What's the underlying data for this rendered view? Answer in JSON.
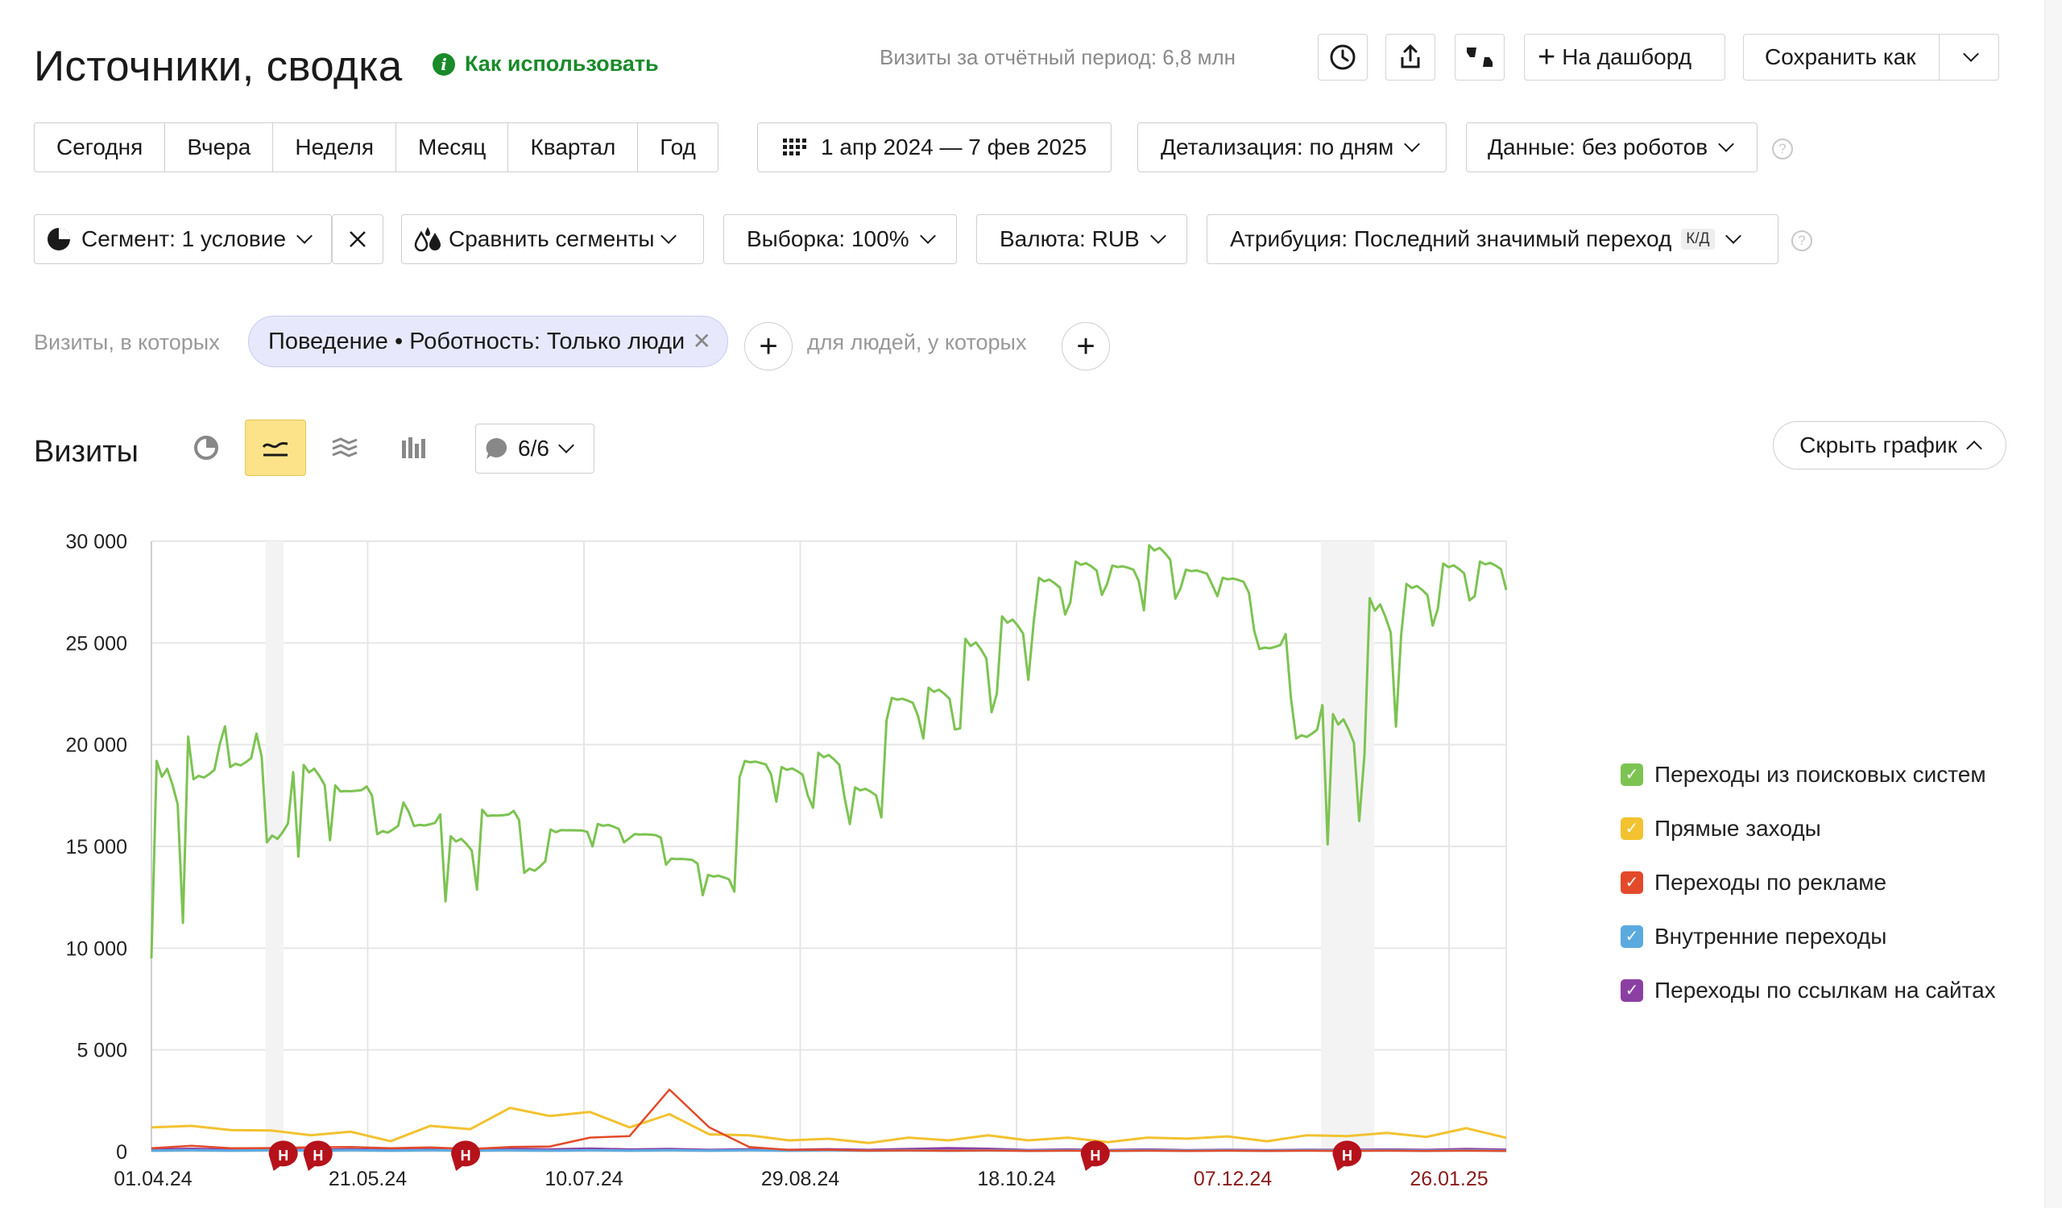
{
  "header": {
    "title": "Источники, сводка",
    "howto_label": "Как использовать",
    "visits_total": "Визиты за отчётный период: 6,8 млн",
    "dashboard_label": "На дашборд",
    "save_as_label": "Сохранить как"
  },
  "period": {
    "tabs": [
      "Сегодня",
      "Вчера",
      "Неделя",
      "Месяц",
      "Квартал",
      "Год"
    ],
    "date_range": "1 апр 2024 — 7 фев 2025",
    "detail": "Детализация: по дням",
    "data": "Данные: без роботов"
  },
  "controls": {
    "segment": "Сегмент: 1 условие",
    "compare": "Сравнить сегменты",
    "sample": "Выборка: 100%",
    "currency": "Валюта: RUB",
    "attribution": "Атрибуция: Последний значимый переход",
    "attribution_badge": "К/Д"
  },
  "filter": {
    "visits_where": "Визиты, в которых",
    "chip": "Поведение • Роботность: Только люди",
    "people_where": "для людей, у которых"
  },
  "chart_header": {
    "title": "Визиты",
    "series_count": "6/6",
    "hide_chart": "Скрыть график"
  },
  "colors": {
    "search": "#7dc352",
    "direct": "#f2c230",
    "ads": "#e24a2a",
    "internal": "#5aaae0",
    "links": "#8c3fa3",
    "accent_green": "#1a8a2a",
    "holiday_marker": "#b5121b"
  },
  "chart_data": {
    "type": "line",
    "x_ticks": [
      "01.04.24",
      "21.05.24",
      "10.07.24",
      "29.08.24",
      "18.10.24",
      "07.12.24",
      "26.01.25"
    ],
    "y_ticks": [
      "30 000",
      "25 000",
      "20 000",
      "15 000",
      "10 000",
      "5 000",
      "0"
    ],
    "ylim": [
      0,
      30000
    ],
    "x_range": [
      "2024-04-01",
      "2025-02-07"
    ],
    "grid": true,
    "legend_position": "right",
    "holiday_marker_label": "Н",
    "series": [
      {
        "name": "Переходы из поисковых систем",
        "color": "#7dc352",
        "weekly": [
          [
            9500,
            19200,
            14800,
            20400,
            18300,
            14700,
            20900,
            18900,
            14100,
            19400,
            15200,
            13100
          ],
          [
            14500,
            19000,
            12600,
            18000,
            17700,
            13000,
            17500,
            15600,
            13100,
            16700,
            12300,
            16000
          ],
          [
            12300,
            15500,
            12400,
            16800,
            16500,
            12600,
            16300,
            13700,
            12300,
            15700,
            11800,
            15800
          ],
          [
            15000,
            11900,
            16100,
            15400,
            12100,
            15600,
            14100,
            11100,
            14400,
            12600,
            11000,
            13600
          ],
          [
            18400,
            14400,
            19200,
            17200,
            14800,
            18900,
            16900,
            14600,
            19600,
            16100,
            17900,
            15600
          ],
          [
            21200,
            16400,
            22300,
            20300,
            17500,
            22800,
            20800,
            17900,
            25200,
            22500,
            19000,
            26300
          ],
          [
            26000,
            20400,
            28200,
            27000,
            20700,
            29000,
            27900,
            21800,
            28800,
            26600,
            21800,
            29800
          ],
          [
            27700,
            21200,
            28600,
            27300,
            21600,
            28200,
            25600,
            17800,
            24700,
            22300,
            18300,
            20300
          ],
          [
            15100,
            10600,
            21500,
            19500,
            18800,
            27200,
            25400,
            20300,
            27900,
            26700,
            21300,
            28900
          ],
          [
            27300,
            22000,
            29000,
            25500
          ]
        ]
      },
      {
        "name": "Прямые заходы",
        "color": "#f2c230",
        "values": [
          1400,
          1100,
          1250,
          900,
          950,
          850,
          600,
          1100,
          1300,
          1900,
          2000,
          1700,
          1400,
          1600,
          1000,
          700,
          650,
          550,
          500,
          600,
          650,
          700,
          650,
          600,
          550,
          600,
          750,
          650,
          600,
          700,
          900,
          800,
          850,
          1000,
          800
        ]
      },
      {
        "name": "Переходы по рекламе",
        "color": "#e24a2a",
        "values": [
          200,
          250,
          200,
          150,
          250,
          200,
          200,
          180,
          150,
          200,
          300,
          600,
          900,
          2800,
          1400,
          200,
          100,
          80,
          60,
          50,
          50,
          50,
          40,
          40,
          40,
          40,
          40,
          40,
          40,
          40,
          40,
          40,
          40,
          40,
          40
        ]
      },
      {
        "name": "Внутренние переходы",
        "color": "#5aaae0",
        "values": [
          60,
          60,
          60,
          60,
          60,
          60,
          60,
          60,
          60,
          60,
          60,
          60,
          60,
          60,
          60,
          60,
          60,
          60,
          60,
          60,
          60,
          60,
          60,
          60,
          60,
          60,
          60,
          60,
          60,
          60,
          60,
          60,
          60,
          60,
          60
        ]
      },
      {
        "name": "Переходы по ссылкам на сайтах",
        "color": "#8c3fa3",
        "values": [
          120,
          120,
          110,
          110,
          100,
          100,
          90,
          90,
          100,
          120,
          130,
          130,
          120,
          110,
          100,
          100,
          100,
          100,
          100,
          110,
          200,
          120,
          90,
          90,
          90,
          90,
          80,
          80,
          80,
          80,
          100,
          90,
          100,
          110,
          110
        ]
      }
    ],
    "holiday_markers_dates": [
      "2024-05-01",
      "2024-05-09",
      "2024-06-12",
      "2024-11-04",
      "2025-01-01"
    ]
  }
}
